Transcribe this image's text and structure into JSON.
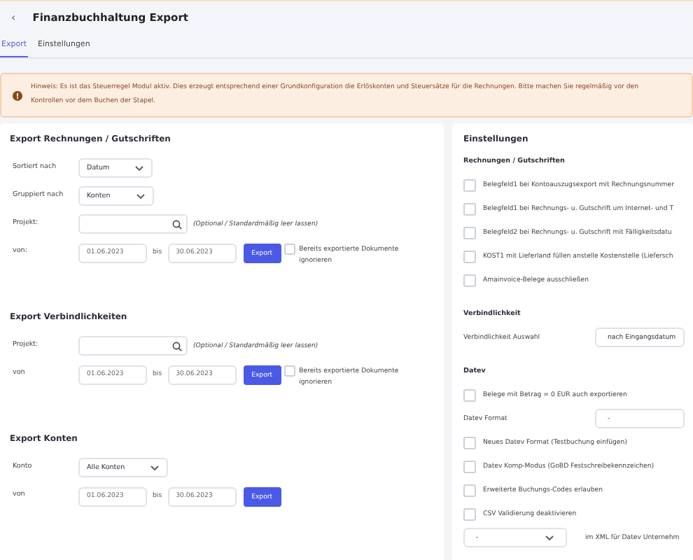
{
  "header": {
    "back": "‹",
    "title": "Finanzbuchhaltung Export"
  },
  "tabs": [
    {
      "label": "Export",
      "selected": true
    },
    {
      "label": "Einstellungen",
      "selected": false
    }
  ],
  "notice": {
    "text": "Hinweis: Es ist das Steuerregel Modul aktiv. Dies erzeugt entsprechend einer Grundkonfiguration die Erlöskonten und Steuersätze für die Rechnungen. Bitte machen Sie regelmäßig vor den\nKontrollen vor dem Buchen der Stapel."
  },
  "export_sections": [
    {
      "title": "Export Rechnungen / Gutschriften",
      "rows": [
        {
          "kind": "select",
          "label": "Sortiert nach",
          "value": "Datum"
        },
        {
          "kind": "select",
          "label": "Gruppiert nach",
          "value": "Konten"
        },
        {
          "kind": "search",
          "label": "Projekt:",
          "hint": "(Optional / Standardmäßig leer lassen)"
        },
        {
          "kind": "range",
          "label": "von:",
          "from": "01.06.2023",
          "between": "bis",
          "to": "30.06.2023",
          "button": "Export",
          "option": {
            "label": "Bereits exportierte Dokumente ignorieren",
            "checked": false
          }
        }
      ]
    },
    {
      "title": "Export Verbindlichkeiten",
      "rows": [
        {
          "kind": "search",
          "label": "Projekt:",
          "hint": "(Optional / Standardmäßig leer lassen)"
        },
        {
          "kind": "range",
          "label": "von",
          "from": "01.06.2023",
          "between": "bis",
          "to": "30.06.2023",
          "button": "Export",
          "option": {
            "label": "Bereits exportierte Dokumente ignorieren",
            "checked": false
          }
        }
      ]
    },
    {
      "title": "Export Konten",
      "rows": [
        {
          "kind": "select",
          "label": "Konto",
          "value": "Alle Konten"
        },
        {
          "kind": "range",
          "label": "von",
          "from": "01.06.2023",
          "between": "bis",
          "to": "30.06.2023",
          "button": "Export"
        }
      ]
    }
  ],
  "settings": {
    "title": "Einstellungen",
    "groups": [
      {
        "title": "Rechnungen / Gutschriften",
        "items": [
          {
            "kind": "checkbox",
            "label": "Belegfeld1 bei Kontoauszugsexport mit Rechnungsnummer",
            "checked": false
          },
          {
            "kind": "checkbox",
            "label": "Belegfeld1 bei Rechnungs- u. Gutschrift um Internet- und T",
            "checked": false
          },
          {
            "kind": "checkbox",
            "label": "Belegfeld2 bei Rechnungs- u. Gutschrift mit Fälligkeitsdatu",
            "checked": false
          },
          {
            "kind": "checkbox",
            "label": "KOST1 mit Lieferland füllen anstelle Kostenstelle (Liefersch",
            "checked": false
          },
          {
            "kind": "checkbox",
            "label": "Amainvoice-Belege ausschließen",
            "checked": false
          }
        ]
      },
      {
        "title": "Verbindlichkeit",
        "items": [
          {
            "kind": "select",
            "label": "Verbindlichkeit Auswahl",
            "value": "nach Eingangsdatum"
          }
        ]
      },
      {
        "title": "Datev",
        "items": [
          {
            "kind": "checkbox",
            "label": "Belege mit Betrag = 0 EUR auch exportieren",
            "checked": false
          },
          {
            "kind": "field",
            "label": "Datev Format",
            "value": "-"
          },
          {
            "kind": "checkbox",
            "label": "Neues Datev Format (Testbuchung einfügen)",
            "checked": false
          },
          {
            "kind": "checkbox",
            "label": "Datev Komp-Modus (GoBD Festschreibekennzeichen)",
            "checked": false
          },
          {
            "kind": "checkbox",
            "label": "Erweiterte Buchungs-Codes erlauben",
            "checked": false
          },
          {
            "kind": "checkbox",
            "label": "CSV Validierung deaktivieren",
            "checked": false
          },
          {
            "kind": "dropdown-text",
            "value": "-",
            "text": "im XML für Datev Unternehm"
          }
        ]
      }
    ]
  }
}
